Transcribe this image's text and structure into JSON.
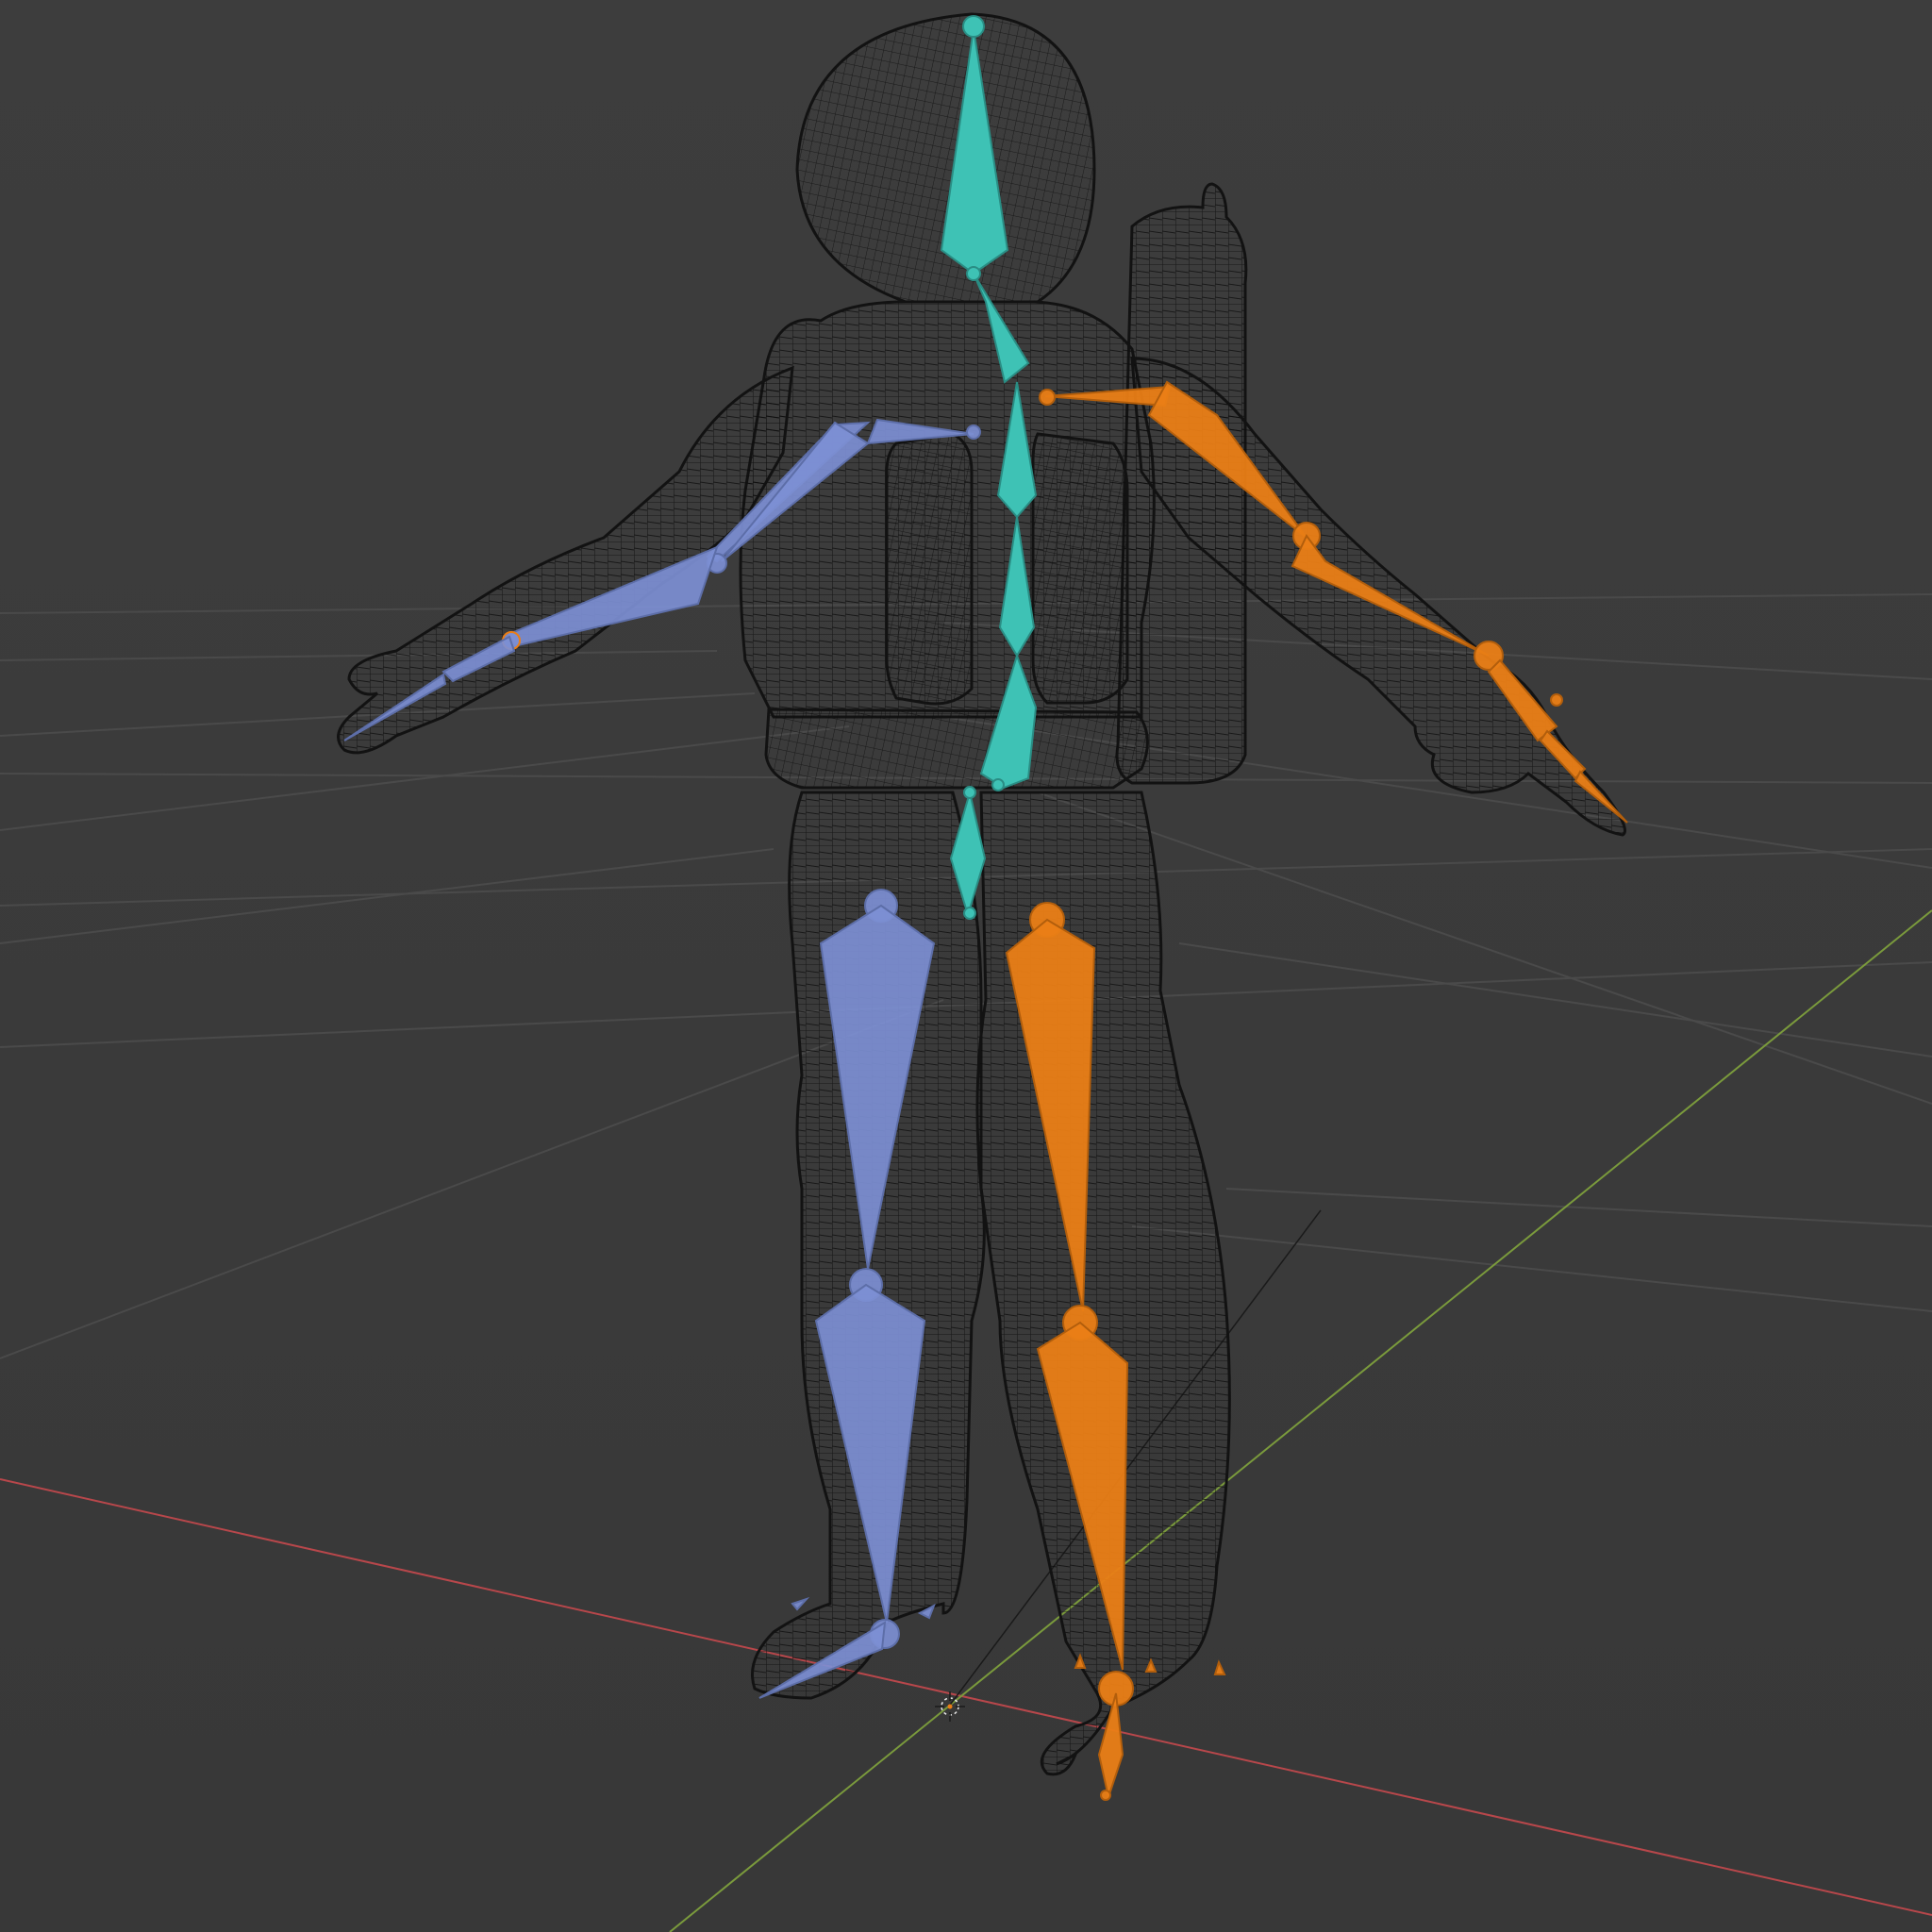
{
  "viewport": {
    "background": "#3a3a3a",
    "grid_color": "#4a4a4a",
    "x_axis_color": "#b8474b",
    "y_axis_color": "#7a9a3c",
    "wire_color": "#121212"
  },
  "bone_colors": {
    "center": "#3ec2b5",
    "center_edge": "#2a8d84",
    "left": "#7d8fd4",
    "left_edge": "#5d6ea8",
    "right": "#ea7e16",
    "right_edge": "#b25e0c"
  },
  "icons": {
    "origin": "3d-cursor-icon"
  }
}
